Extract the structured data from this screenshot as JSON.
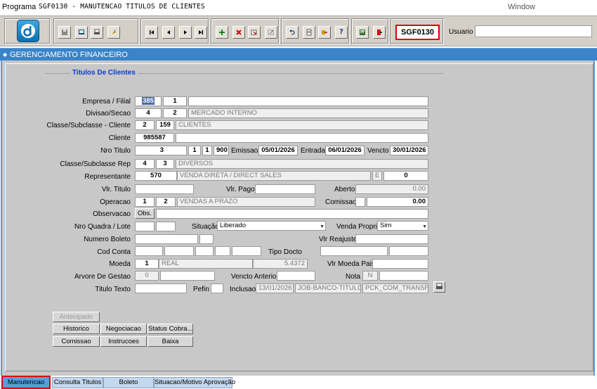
{
  "menubar": {
    "programa": "Programa",
    "title": "SGF0130 - MANUTENCAO TITULOS DE CLIENTES",
    "window": "Window"
  },
  "toolbar": {
    "program_code": "SGF0130",
    "usuario_label": "Usuario",
    "usuario_value": "",
    "icons": [
      "save-icon",
      "screen-icon",
      "print-preview-icon",
      "help-tool-icon",
      "first-record-icon",
      "previous-record-icon",
      "next-record-icon",
      "last-record-icon",
      "insert-record-icon",
      "delete-record-icon",
      "edit-record-icon",
      "clear-record-icon",
      "undo-icon",
      "clipboard-icon",
      "export-icon",
      "help-icon",
      "calculator-icon",
      "exit-icon"
    ]
  },
  "window": {
    "title": "GERENCIAMENTO FINANCEIRO"
  },
  "section": {
    "title": "Titulos De Clientes"
  },
  "form": {
    "empresa_label": "Empresa / Filial",
    "empresa": "385",
    "filial": "1",
    "empresa_desc": "",
    "divisao_label": "Divisao/Secao",
    "divisao": "4",
    "secao": "2",
    "divisao_desc": "MERCADO INTERNO",
    "classe_label": "Classe/Subclasse - Cliente",
    "classe": "2",
    "subclasse": "159",
    "classe_desc": "CLIENTES",
    "cliente_label": "Cliente",
    "cliente": "985587",
    "cliente_desc": "",
    "nro_titulo_label": "Nro Titulo",
    "nro_titulo": "3",
    "nro_titulo_a": "1",
    "nro_titulo_b": "1",
    "nro_titulo_c": "900",
    "emissao_label": "Emissao",
    "emissao": "05/01/2026",
    "entrada_label": "Entrada",
    "entrada": "06/01/2026",
    "vencto_label": "Vencto",
    "vencto": "30/01/2026",
    "classe_rep_label": "Classe/Subclasse Rep",
    "classe_rep": "4",
    "subclasse_rep": "3",
    "classe_rep_desc": "DIVERSOS",
    "representante_label": "Representante",
    "representante": "570",
    "representante_desc": "VENDA DIRETA / DIRECT SALES",
    "representante_tipo": "E",
    "representante_val": "0",
    "vlr_titulo_label": "Vlr. Titulo",
    "vlr_titulo": "",
    "vlr_pago_label": "Vlr. Pago",
    "vlr_pago": "",
    "aberto_label": "Aberto",
    "aberto": "0.00",
    "operacao_label": "Operacao",
    "operacao": "1",
    "operacao_b": "2",
    "operacao_desc": "VENDAS A PRAZO",
    "comissao_label": "Comissao",
    "comissao_flag": "",
    "comissao": "0.00",
    "observacao_label": "Observacao",
    "obs_button": "Obs.",
    "observacao": "",
    "quadra_label": "Nro Quadra / Lote",
    "situacao_label": "Situação",
    "situacao": "Liberado",
    "venda_propria_label": "Venda Propria",
    "venda_propria": "Sim",
    "boleto_label": "Numero Boleto",
    "reajuste_label": "Vlr Reajuste",
    "cod_conta_label": "Cod Conta",
    "tipo_docto_label": "Tipo Docto",
    "moeda_label": "Moeda",
    "moeda": "1",
    "moeda_desc": "REAL",
    "moeda_valor": "5.4372",
    "moeda_pais_label": "Vlr Moeda Pais",
    "arvore_label": "Arvore De Gestao",
    "arvore": "0",
    "vencto_anterior_label": "Vencto Anterior",
    "nota_label": "Nota",
    "nota": "N",
    "titulo_texto_label": "Titulo Texto",
    "pefin_label": "Pefin",
    "inclusao_label": "Inclusao",
    "inclusao_data": "13/01/2026",
    "inclusao_user": "JOB-BANCO-TITULO",
    "inclusao_proc": "PCK_COM_TRANSF_N"
  },
  "buttons": {
    "antecipado": "Antecipado",
    "historico": "Historico",
    "negociacao": "Negociacao",
    "status_cobra": "Status Cobra...",
    "comissao": "Comissao",
    "instrucoes": "Instrucoes",
    "baixa": "Baixa"
  },
  "tabs": [
    "Manutencao",
    "Consulta Titulos",
    "Boleto",
    "Situacao/Motivo Aprovação"
  ],
  "colors": {
    "accent": "#3a84c8",
    "highlight": "#e00000",
    "section_title": "#0a3bd0"
  }
}
